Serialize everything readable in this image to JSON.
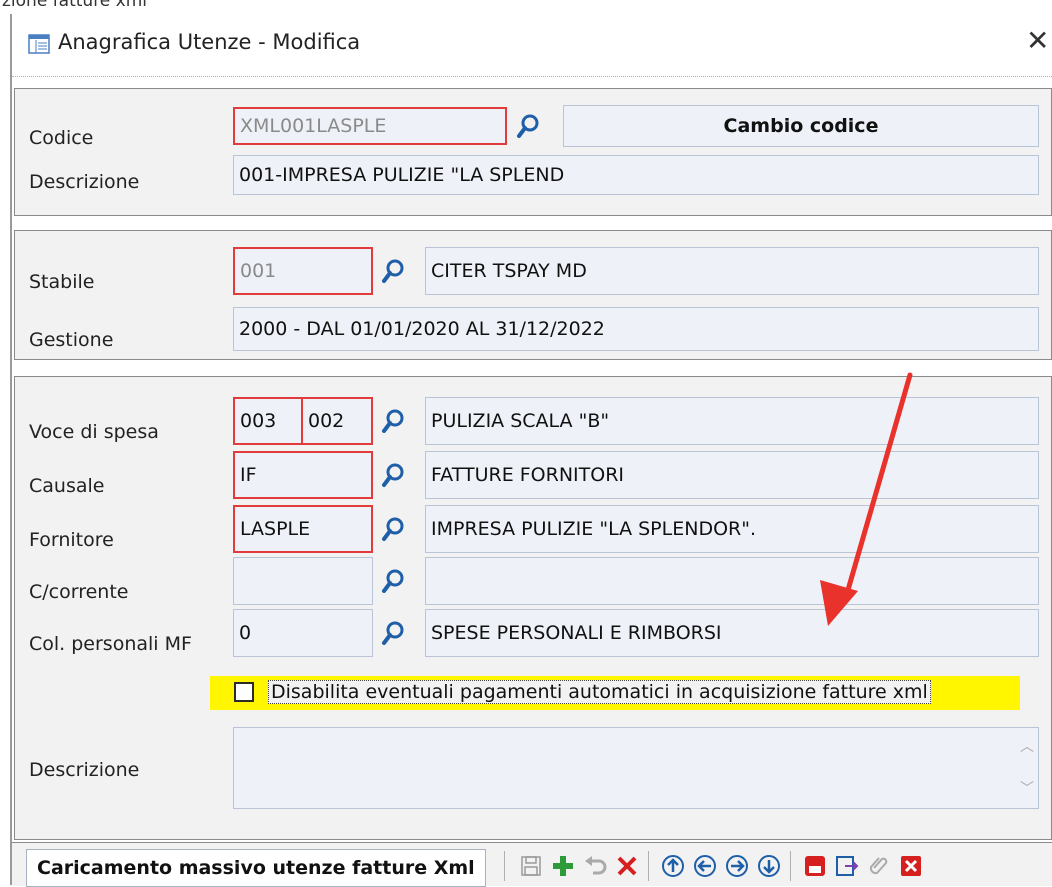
{
  "background": {
    "partial_text_left": "zione fatture xml"
  },
  "window": {
    "title": "Anagrafica Utenze - Modifica",
    "close_glyph": "✕"
  },
  "section1": {
    "codice_label": "Codice",
    "codice_value": "XML001LASPLE",
    "cambio_codice_label": "Cambio codice",
    "descrizione_label": "Descrizione",
    "descrizione_value": "001-IMPRESA PULIZIE \"LA SPLEND"
  },
  "section2": {
    "stabile_label": "Stabile",
    "stabile_code": "001",
    "stabile_desc": "CITER TSPAY MD",
    "gestione_label": "Gestione",
    "gestione_value": "2000 - DAL 01/01/2020 AL 31/12/2022"
  },
  "section3": {
    "voce_label": "Voce di spesa",
    "voce_code1": "003",
    "voce_code2": "002",
    "voce_desc": "PULIZIA SCALA \"B\"",
    "causale_label": "Causale",
    "causale_code": "IF",
    "causale_desc": "FATTURE FORNITORI",
    "fornitore_label": "Fornitore",
    "fornitore_code": "LASPLE",
    "fornitore_desc": "IMPRESA PULIZIE \"LA SPLENDOR\".",
    "ccorrente_label": "C/corrente",
    "ccorrente_code": "",
    "ccorrente_desc": "",
    "colpers_label": "Col. personali MF",
    "colpers_code": "0",
    "colpers_desc": "SPESE PERSONALI E RIMBORSI",
    "checkbox_label": "Disabilita eventuali pagamenti automatici in acquisizione fatture xml",
    "checkbox_checked": false,
    "descrizione_label": "Descrizione",
    "descrizione_value": ""
  },
  "toolbar": {
    "mass_button_label": "Caricamento massivo utenze fatture Xml",
    "icons": [
      "save-icon",
      "add-icon",
      "undo-icon",
      "delete-icon",
      "arrow-up-icon",
      "arrow-left-icon",
      "arrow-right-icon",
      "arrow-down-icon",
      "youtube-icon",
      "export-icon",
      "attach-icon",
      "close-icon"
    ]
  },
  "colors": {
    "required_border": "#e23b3b",
    "field_bg": "#eef2f8",
    "highlight": "#fff600",
    "annotation_arrow": "#e8322b",
    "lens_blue": "#1f5fa8"
  }
}
